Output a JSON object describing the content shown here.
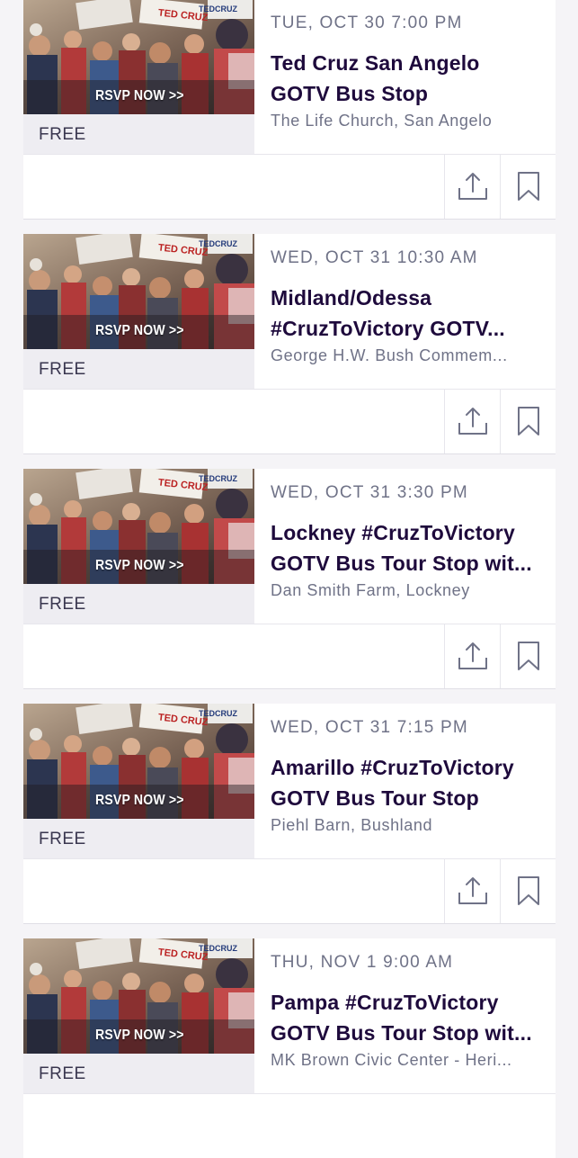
{
  "colors": {
    "title": "#1e0a3c",
    "meta": "#6f7287",
    "price_bg": "#eeedf2",
    "page_bg": "#f5f4f7"
  },
  "events": [
    {
      "date": "TUE, OCT 30 7:00 PM",
      "title": "Ted Cruz San Angelo GOTV Bus Stop",
      "venue": "The Life Church, San Angelo",
      "price": "FREE",
      "image_label": "RSVP NOW >>",
      "share_icon": "share-icon",
      "save_icon": "bookmark-icon"
    },
    {
      "date": "WED, OCT 31 10:30 AM",
      "title": "Midland/Odessa #CruzToVictory GOTV...",
      "venue": "George H.W. Bush Commem...",
      "price": "FREE",
      "image_label": "RSVP NOW >>",
      "share_icon": "share-icon",
      "save_icon": "bookmark-icon"
    },
    {
      "date": "WED, OCT 31 3:30 PM",
      "title": "Lockney #CruzToVictory GOTV Bus Tour Stop wit...",
      "venue": "Dan Smith Farm, Lockney",
      "price": "FREE",
      "image_label": "RSVP NOW >>",
      "share_icon": "share-icon",
      "save_icon": "bookmark-icon"
    },
    {
      "date": "WED, OCT 31 7:15 PM",
      "title": "Amarillo #CruzToVictory GOTV Bus Tour Stop",
      "venue": "Piehl Barn, Bushland",
      "price": "FREE",
      "image_label": "RSVP NOW >>",
      "share_icon": "share-icon",
      "save_icon": "bookmark-icon"
    },
    {
      "date": "THU, NOV 1 9:00 AM",
      "title": "Pampa #CruzToVictory GOTV Bus Tour Stop wit...",
      "venue": "MK Brown Civic Center - Heri...",
      "price": "FREE",
      "image_label": "RSVP NOW >>",
      "share_icon": "share-icon",
      "save_icon": "bookmark-icon"
    }
  ]
}
